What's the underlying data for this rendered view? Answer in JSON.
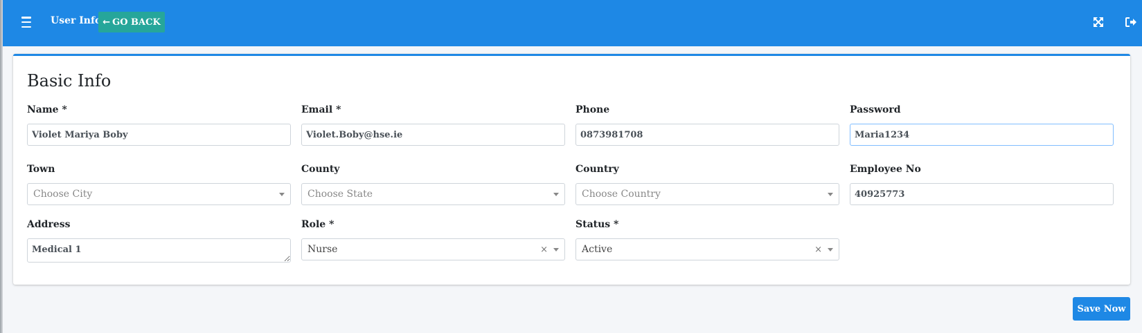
{
  "header": {
    "title": "User Info",
    "go_back_label": "GO BACK",
    "accent": "#1e88e5",
    "go_back_color": "#26a69a"
  },
  "form": {
    "title": "Basic Info",
    "name": {
      "label": "Name *",
      "value": "Violet Mariya Boby"
    },
    "email": {
      "label": "Email *",
      "value": "Violet.Boby@hse.ie"
    },
    "phone": {
      "label": "Phone",
      "value": "0873981708"
    },
    "password": {
      "label": "Password",
      "value": "Maria1234"
    },
    "town": {
      "label": "Town",
      "placeholder": "Choose City"
    },
    "county": {
      "label": "County",
      "placeholder": "Choose State"
    },
    "country": {
      "label": "Country",
      "placeholder": "Choose Country"
    },
    "employee_no": {
      "label": "Employee No",
      "value": "40925773"
    },
    "address": {
      "label": "Address",
      "value": "Medical 1"
    },
    "role": {
      "label": "Role *",
      "value": "Nurse"
    },
    "status": {
      "label": "Status *",
      "value": "Active"
    }
  },
  "actions": {
    "save_label": "Save Now"
  },
  "icons": {
    "menu": "menu-icon",
    "fullscreen": "fullscreen-icon",
    "logout": "logout-icon",
    "back": "arrow-left-icon"
  }
}
